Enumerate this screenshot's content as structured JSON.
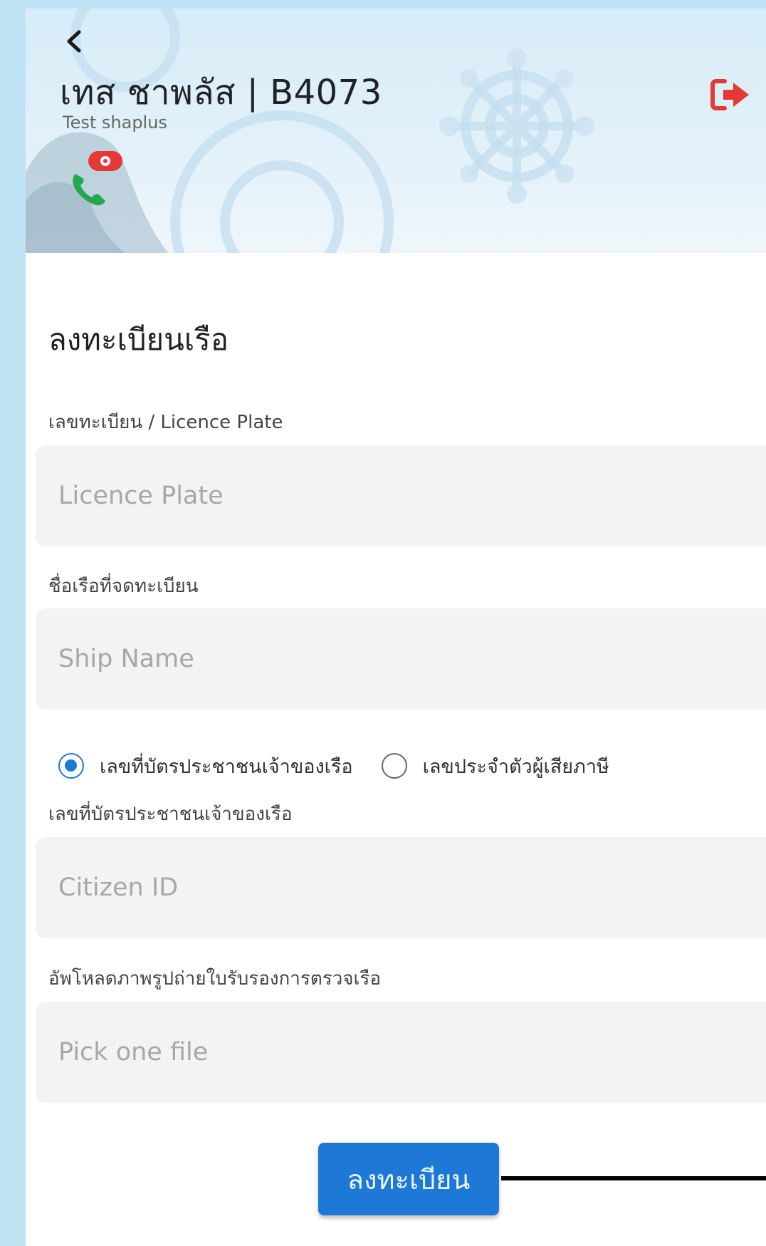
{
  "header": {
    "title": "เทส ชาพลัส | B4073",
    "subtitle": "Test shaplus",
    "back_icon": "chevron-left-icon",
    "logout_icon": "logout-icon",
    "support_icon": "phone-support-icon",
    "accent_color": "#e53935"
  },
  "form": {
    "section_title": "ลงทะเบียนเรือ",
    "license": {
      "label": "เลขทะเบียน / Licence Plate",
      "placeholder": "Licence Plate",
      "value": ""
    },
    "ship_name": {
      "label": "ชื่อเรือที่จดทะเบียน",
      "placeholder": "Ship Name",
      "value": ""
    },
    "id_type": {
      "options": [
        {
          "label": "เลขที่บัตรประชาชนเจ้าของเรือ",
          "selected": true
        },
        {
          "label": "เลขประจำตัวผู้เสียภาษี",
          "selected": false
        }
      ]
    },
    "citizen": {
      "label": "เลขที่บัตรประชาชนเจ้าของเรือ",
      "placeholder": "Citizen ID",
      "value": ""
    },
    "upload": {
      "label": "อัพโหลดภาพรูปถ่ายใบรับรองการตรวจเรือ",
      "placeholder": "Pick one file",
      "value": ""
    },
    "submit_label": "ลงทะเบียน",
    "primary_color": "#1e78d6"
  }
}
